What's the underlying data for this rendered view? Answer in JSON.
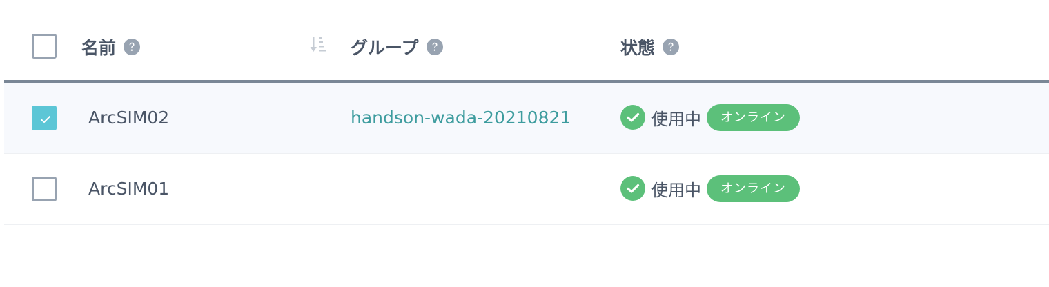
{
  "header": {
    "name_label": "名前",
    "group_label": "グループ",
    "status_label": "状態",
    "select_all_checked": false
  },
  "icons": {
    "help": "question-circle-icon",
    "sort": "sort-amount-down-icon",
    "status_ok": "check-circle-icon",
    "checkbox_check": "checkmark-icon"
  },
  "colors": {
    "accent": "#5cc6d6",
    "link": "#3d9c9e",
    "online": "#5cc07a",
    "text": "#4a5566",
    "muted": "#98a3b1"
  },
  "rows": [
    {
      "checked": true,
      "name": "ArcSIM02",
      "group": "handson-wada-20210821",
      "status": "使用中",
      "connection": "オンライン"
    },
    {
      "checked": false,
      "name": "ArcSIM01",
      "group": "",
      "status": "使用中",
      "connection": "オンライン"
    }
  ]
}
